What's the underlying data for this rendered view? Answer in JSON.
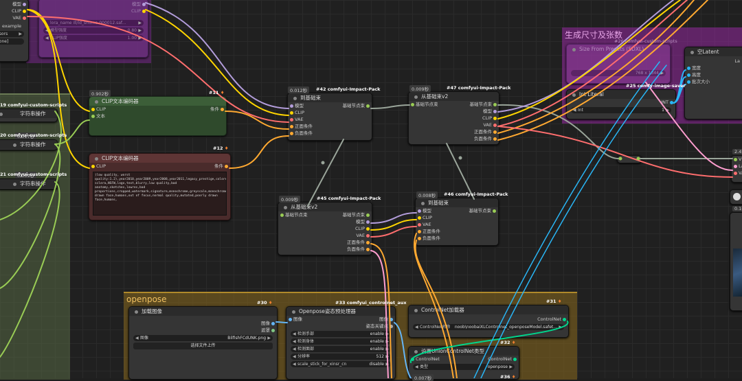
{
  "groups": {
    "size_group_title": "生成尺寸及张数",
    "openpose_group_title": "openpose"
  },
  "colors": {
    "model": "#b39ddb",
    "clip": "#ffd500",
    "vae": "#ff6e6e",
    "conditioning": "#ffa931",
    "image": "#64b5f6",
    "controlnet": "#00d78d",
    "int": "#29b6f6",
    "pipe": "#99cc55",
    "link_gray": "#9aa59a"
  },
  "top_left": {
    "rows": [
      "模型",
      "CLIP",
      "VAE"
    ],
    "example": "example",
    "sensors_widget": "nsors",
    "none_widget": "none]"
  },
  "purple_loader": {
    "rows": [
      "模型",
      "CLIP"
    ],
    "lora_name": "lora_name  ill/ld_shuma-000012.saf...",
    "strength_model_label": "模型强度",
    "strength_model": "0.80",
    "strength_clip_label": "CLIP强度",
    "strength_clip": "1.00"
  },
  "left_group": {
    "node19_title": "19 comfyui-custom-scripts",
    "node19_item": "字符串操作",
    "node20_title": "20 comfyui-custom-scripts",
    "node20_time": "0.017秒",
    "node20_item": "字符串操作",
    "node21_title": "21 comfyui-custom-scripts",
    "node21_time": "0.009秒",
    "node21_item": "字符串操作"
  },
  "clip_text_1": {
    "time": "0.902秒",
    "id": "#11",
    "title": "CLIP文本编码器",
    "in_clip": "CLIP",
    "in_text": "文本",
    "out": "条件"
  },
  "clip_text_2": {
    "id": "#12",
    "title": "CLIP文本编码器",
    "in_clip": "CLIP",
    "out": "条件",
    "text": "(low quality, worst quality:1.2),year2010,year2009,year2008,year2011,legacy_prestige,colored sclera,NSFW,logo,text,blurry,low quality,bad anatomy,sketches,lowres,bad proportions,cropped,watermark,signature,monochrome,greyscale,monochrome,nsfw,mutated,poorly drawn face,humans,out of focus,normal quality,mutated,poorly drawn face,humans,"
  },
  "node42": {
    "time": "0.012秒",
    "id": "#42 comfyui-Impact-Pack",
    "title": "到基础束",
    "inputs": [
      "模型",
      "CLIP",
      "VAE",
      "正面条件",
      "负面条件"
    ],
    "output": "基础节点束"
  },
  "node45": {
    "time": "0.009秒",
    "id": "#45 comfyui-Impact-Pack",
    "title": "从基础束v2",
    "input": "基础节点束",
    "outputs": [
      "基础节点束",
      "模型",
      "CLIP",
      "VAE",
      "正面条件",
      "负面条件"
    ]
  },
  "node47": {
    "time": "0.009秒",
    "id": "#47 comfyui-Impact-Pack",
    "title": "从基础束v2",
    "input": "基础节点束",
    "outputs": [
      "基础节点束",
      "模型",
      "CLIP",
      "VAE",
      "正面条件",
      "负面条件"
    ]
  },
  "node46": {
    "time": "0.008秒",
    "id": "#46 comfyui-Impact-Pack",
    "title": "到基础束",
    "inputs": [
      "模型",
      "CLIP",
      "VAE",
      "正面条件",
      "负面条件"
    ],
    "output": "基础节点束"
  },
  "size_group": {
    "preset_title": "Size From Presets (SDXL)",
    "preset_id": "#26 comfyui-custom-scripts",
    "preset_widget": "768 x 1344",
    "int_literal_title": "Int Literal",
    "int_literal_id": "#25 comfy-image-saver",
    "int_label": "Int",
    "int_value": "1",
    "int_out": "INT",
    "latent_title": "空Latent",
    "latent_inputs": [
      "宽度",
      "高度",
      "批次大小"
    ],
    "latent_out": "La"
  },
  "right_partial": {
    "time1": "2.47",
    "rows": [
      "V",
      "La",
      "VA"
    ],
    "time2": "0.16"
  },
  "node30": {
    "id": "#30",
    "title": "加载图像",
    "outputs": [
      "图像",
      "遮罩"
    ],
    "image_label": "图像",
    "image_value": "BilfishFCdUNK.png",
    "upload_button": "选择文件上传"
  },
  "node33": {
    "id": "#33 comfyui_controlnet_aux",
    "title": "Openpose姿态预处理器",
    "input": "图像",
    "outputs": [
      "图像",
      "姿态关键点"
    ],
    "widgets": [
      {
        "label": "检测手部",
        "value": "enable"
      },
      {
        "label": "检测身体",
        "value": "enable"
      },
      {
        "label": "检测面部",
        "value": "enable"
      },
      {
        "label": "分辨率",
        "value": "512"
      },
      {
        "label": "scale_stick_for_xinsr_cn",
        "value": "disable"
      }
    ]
  },
  "node31": {
    "id": "#31",
    "title": "ControlNet加载器",
    "output": "ControlNet",
    "widget_label": "ControlNet名称",
    "widget_value": "noob\\noobaiXLControlnet_openposeModel.safet..."
  },
  "node32": {
    "id": "#32",
    "title": "设置UnionControlNet类型",
    "input": "ControlNet",
    "output": "ControlNet",
    "type_label": "类型",
    "type_value": "openpose",
    "time": "0.007秒",
    "id2": "#36"
  }
}
